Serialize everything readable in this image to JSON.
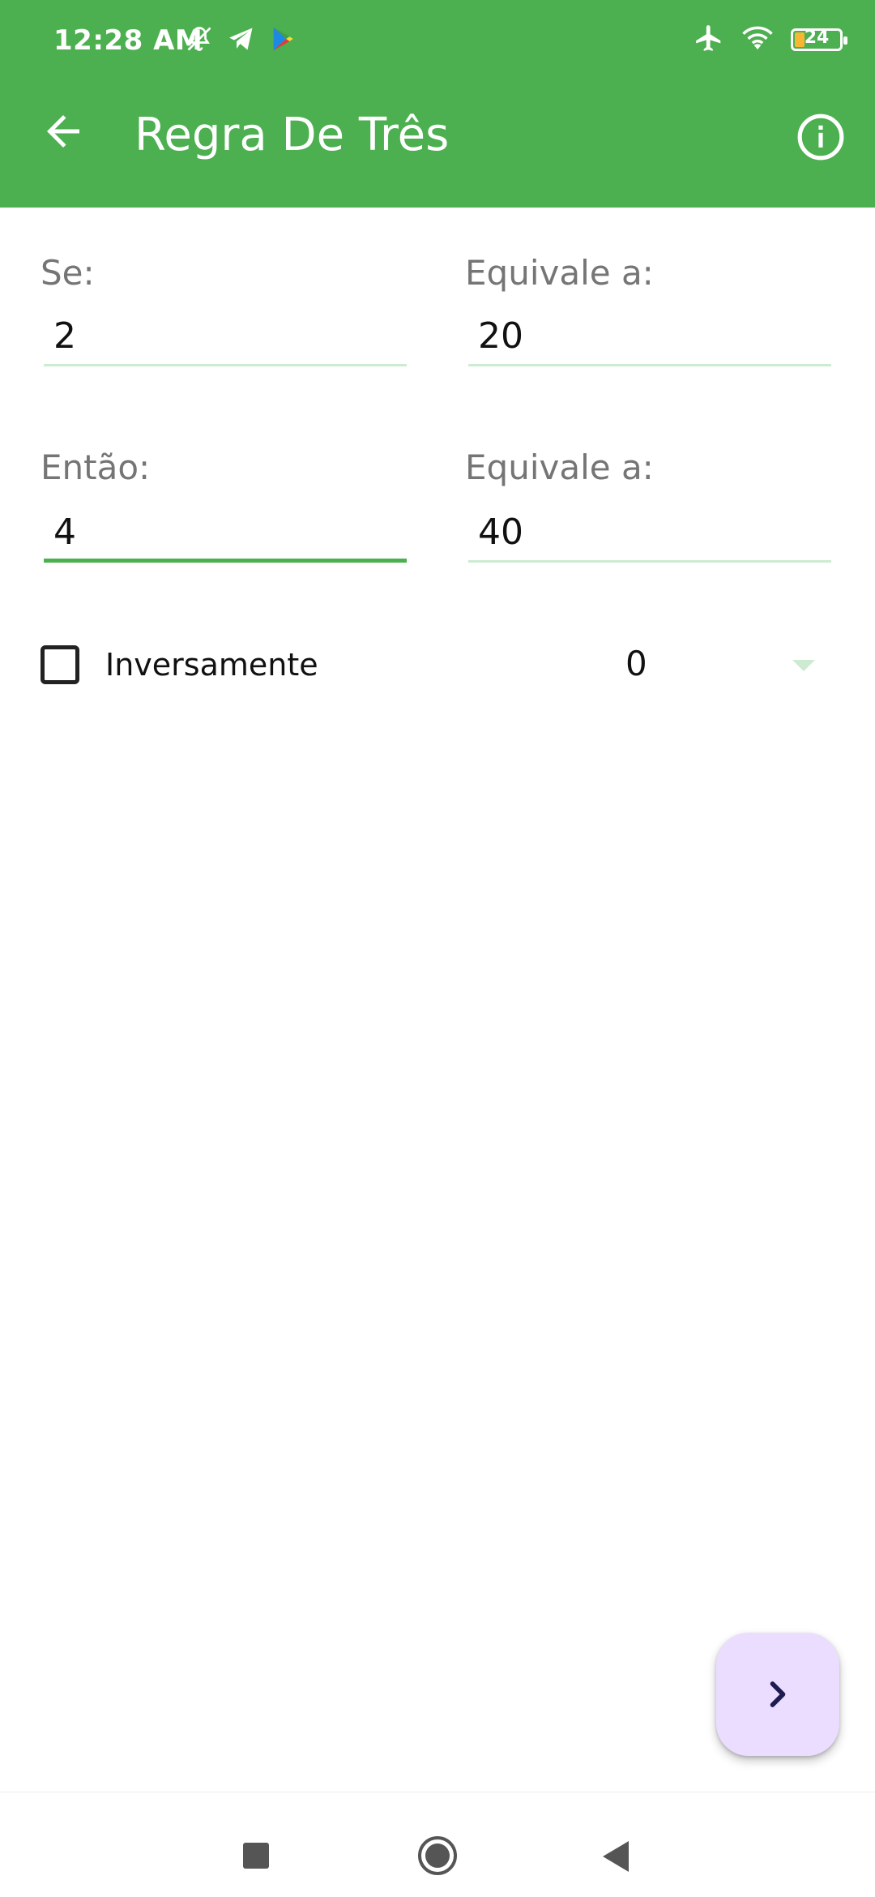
{
  "status_bar": {
    "time": "12:28 AM",
    "battery": "24"
  },
  "app_bar": {
    "title": "Regra De Três",
    "back_icon": "arrow-back-icon",
    "info_icon": "info-icon"
  },
  "form": {
    "se": {
      "label": "Se:",
      "value": "2"
    },
    "equivale_1": {
      "label": "Equivale a:",
      "value": "20"
    },
    "entao": {
      "label": "Então:",
      "value": "4"
    },
    "equivale_2": {
      "label": "Equivale a:",
      "value": "40"
    },
    "inversamente": {
      "label": "Inversamente",
      "checked": false
    },
    "decimal_select": {
      "value": "0"
    }
  },
  "fab": {
    "icon": "chevron-right-icon"
  },
  "colors": {
    "primary": "#4CAF50",
    "fab_bg": "#EADDFF",
    "fab_icon": "#1D1B4F",
    "underline": "#CDEBD0"
  }
}
